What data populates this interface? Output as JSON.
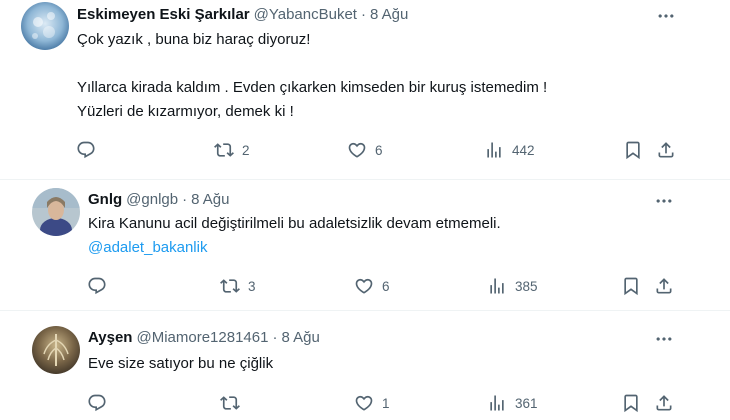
{
  "tweets": [
    {
      "author_name": "Eskimeyen Eski Şarkılar",
      "handle": "@YabancBuket",
      "separator": "·",
      "date": "8 Ağu",
      "lines": [
        "Çok yazık , buna biz haraç diyoruz!",
        "Yıllarca kirada kaldım . Evden çıkarken kimseden bir kuruş istemedim !",
        "Yüzleri de kızarmıyor, demek ki !"
      ],
      "retweets": "2",
      "likes": "6",
      "views": "442"
    },
    {
      "author_name": "Gnlg",
      "handle": "@gnlgb",
      "separator": "·",
      "date": "8 Ağu",
      "lines": [
        "Kira Kanunu acil değiştirilmeli bu adaletsizlik devam etmemeli."
      ],
      "mention": "@adalet_bakanlik",
      "retweets": "3",
      "likes": "6",
      "views": "385"
    },
    {
      "author_name": "Ayşen",
      "handle": "@Miamore1281461",
      "separator": "·",
      "date": "8 Ağu",
      "lines": [
        "Eve size satıyor bu ne çiğlik"
      ],
      "retweets": "",
      "likes": "1",
      "views": "361"
    }
  ],
  "colors": {
    "text": "#0f1419",
    "secondary": "#536471",
    "link": "#1d9bf0",
    "divider": "#eff3f4"
  },
  "icons": [
    "reply-icon",
    "retweet-icon",
    "like-icon",
    "views-icon",
    "bookmark-icon",
    "share-icon",
    "more-icon"
  ]
}
